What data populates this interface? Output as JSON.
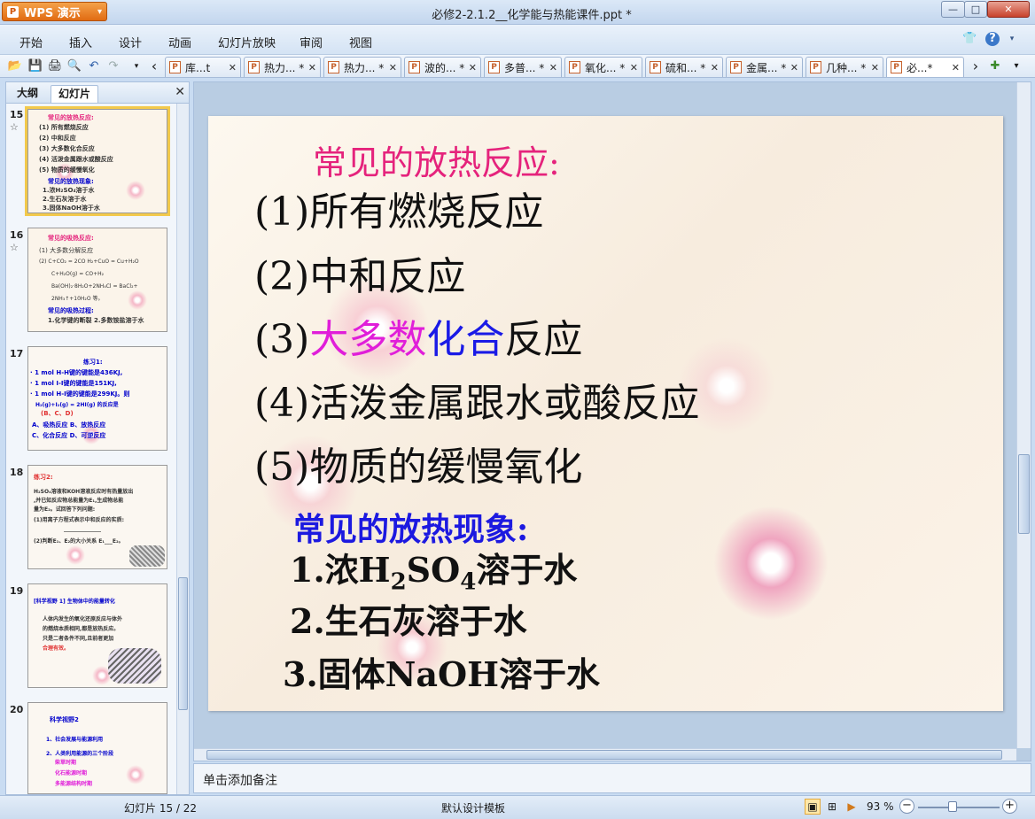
{
  "app": {
    "name": "WPS 演示",
    "logo_glyph": "P",
    "caret": "▾"
  },
  "window": {
    "title": "必修2-2.1.2__化学能与热能课件.ppt *",
    "min_glyph": "—",
    "max_glyph": "□",
    "close_glyph": "✕"
  },
  "menu": [
    "开始",
    "插入",
    "设计",
    "动画",
    "幻灯片放映",
    "审阅",
    "视图"
  ],
  "menu_right": {
    "shirt_icon": "👕",
    "help_icon": "?",
    "help_caret": "▾"
  },
  "toolbar_icons": [
    "📂",
    "💾",
    "🖨",
    "🔍",
    "↶",
    "↷",
    "▾",
    "‹"
  ],
  "doc_tabs": [
    {
      "label": "库...t",
      "close": "✕"
    },
    {
      "label": "热力... *",
      "close": "✕"
    },
    {
      "label": "热力... *",
      "close": "✕"
    },
    {
      "label": "波的... *",
      "close": "✕"
    },
    {
      "label": "多普... *",
      "close": "✕"
    },
    {
      "label": "氧化... *",
      "close": "✕"
    },
    {
      "label": "硫和... *",
      "close": "✕"
    },
    {
      "label": "金属... *",
      "close": "✕"
    },
    {
      "label": "几种... *",
      "close": "✕"
    },
    {
      "label": "必...*",
      "close": "✕"
    }
  ],
  "tab_controls": {
    "next": "›",
    "add": "✚",
    "menu": "▾"
  },
  "left_panel": {
    "tabs": [
      "大纲",
      "幻灯片"
    ],
    "close": "✕",
    "thumbnails": [
      {
        "num": "15",
        "star": "☆",
        "title": "常见的放热反应:",
        "lines": [
          "(1) 所有燃烧反应",
          "(2) 中和反应",
          "(3) 大多数化合反应",
          "(4) 活泼金属跟水或酸反应",
          "(5) 物质的缓慢氧化",
          "常见的放热现象:",
          "1.浓H₂SO₄溶于水",
          "2.生石灰溶于水",
          "3.固体NaOH溶于水"
        ]
      },
      {
        "num": "16",
        "star": "☆",
        "title": "常见的吸热反应:",
        "lines": [
          "(1) 大多数分解反应",
          "(2) C+CO₂ = 2CO    H₂+CuO = Cu+H₂O",
          "C+H₂O(g) = CO+H₂",
          "Ba(OH)₂·8H₂O+2NH₄Cl = BaCl₂+",
          "2NH₃↑+10H₂O 等。",
          "常见的吸热过程:",
          "1.化学键的断裂  2.多数铵盐溶于水"
        ]
      },
      {
        "num": "17",
        "star": "",
        "title": "练习1:",
        "lines": [
          "· 1 mol H-H键的键能是436KJ,",
          "· 1 mol I-I键的键能是151KJ,",
          "· 1 mol H-I键的键能是299KJ。则",
          "H₂(g)+I₂(g) = 2HI(g) 的反应是",
          "(B、C、D)",
          "A、吸热反应      B、放热反应",
          "C、化合反应      D、可逆反应"
        ]
      },
      {
        "num": "18",
        "star": "",
        "title": "练习2:",
        "lines": [
          "H₂SO₄溶液和KOH溶液反应时有热量放出",
          ",并已知反应物总能量为E₁,生成物总能",
          "量为E₂。试回答下列问题:",
          "(1)用离子方程式表示中和反应的实质:",
          "______________",
          "(2)判断E₁、E₂的大小关系  E₁___E₂。"
        ]
      },
      {
        "num": "19",
        "star": "",
        "title": "[科学视野 1]  生物体中的能量转化",
        "lines": [
          "人体内发生的氧化还原反应与体外",
          "的燃烧本质相同,都是放热反应。",
          "只是二者条件不同,且前者更加",
          "合理有效。"
        ]
      },
      {
        "num": "20",
        "star": "",
        "title": "科学视野2",
        "lines": [
          "1、社会发展与能源利用",
          "2、人类利用能源的三个阶段",
          "柴草时期",
          "化石能源时期",
          "多能源结构时期"
        ]
      }
    ]
  },
  "slide": {
    "heading": "常见的放热反应:",
    "items": [
      {
        "prefix": "(1)",
        "parts": [
          {
            "text": "所有燃烧反应",
            "color": "#111111"
          }
        ]
      },
      {
        "prefix": "(2)",
        "parts": [
          {
            "text": "中和反应",
            "color": "#111111"
          }
        ]
      },
      {
        "prefix": "(3)",
        "parts": [
          {
            "text": "大多数",
            "color": "#e01ed9"
          },
          {
            "text": "化合",
            "color": "#1a1ae6"
          },
          {
            "text": "反应",
            "color": "#111111"
          }
        ]
      },
      {
        "prefix": "(4)",
        "parts": [
          {
            "text": "活泼金属跟水或酸反应",
            "color": "#111111"
          }
        ]
      },
      {
        "prefix": "(5)",
        "parts": [
          {
            "text": "物质的缓慢氧化",
            "color": "#111111"
          }
        ]
      }
    ],
    "phenomena_heading": "常见的放热现象:",
    "phenomena": [
      {
        "prefix": "1.",
        "text_before": "浓H",
        "sub1": "2",
        "mid": "SO",
        "sub2": "4",
        "text_after": "溶于水"
      },
      {
        "prefix": "2.",
        "text": "生石灰溶于水"
      },
      {
        "prefix": "3.",
        "text": "固体NaOH溶于水"
      }
    ],
    "colors": {
      "heading": "#e5237c",
      "phen_heading": "#1c19e0",
      "magenta": "#e01ed9",
      "blue": "#1a1ae6"
    }
  },
  "notes": {
    "placeholder": "单击添加备注"
  },
  "status": {
    "slide_indicator": "幻灯片 15 / 22",
    "template": "默认设计模板",
    "zoom": "93 %",
    "zoom_fraction": 0.42
  }
}
